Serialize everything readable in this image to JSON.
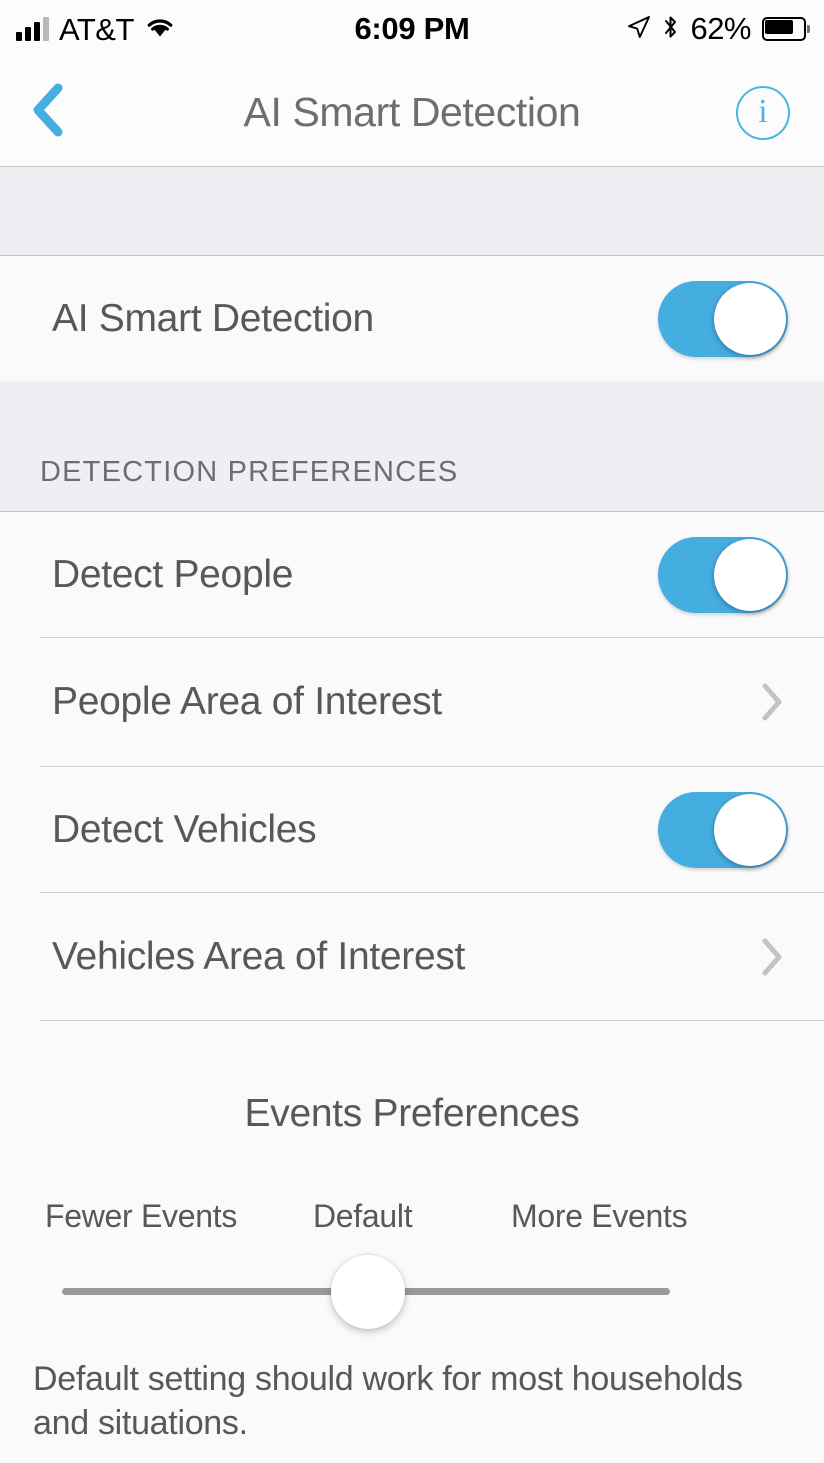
{
  "status_bar": {
    "carrier": "AT&T",
    "time": "6:09 PM",
    "battery_percent": "62%",
    "icons": {
      "signal": "cellular-signal-icon",
      "wifi": "wifi-icon",
      "location": "location-arrow-icon",
      "bluetooth": "bluetooth-icon",
      "battery": "battery-icon"
    }
  },
  "nav_bar": {
    "title": "AI Smart Detection",
    "back_icon": "chevron-left-icon",
    "info_label": "i",
    "info_icon": "info-circle-icon"
  },
  "sections": {
    "main": {
      "rows": [
        {
          "label": "AI Smart Detection",
          "control": "toggle",
          "value": "on"
        }
      ]
    },
    "detection_preferences": {
      "header": "DETECTION PREFERENCES",
      "rows": [
        {
          "label": "Detect People",
          "control": "toggle",
          "value": "on"
        },
        {
          "label": "People Area of Interest",
          "control": "disclosure"
        },
        {
          "label": "Detect Vehicles",
          "control": "toggle",
          "value": "on"
        },
        {
          "label": "Vehicles Area of Interest",
          "control": "disclosure"
        }
      ]
    },
    "events_preferences": {
      "title": "Events Preferences",
      "slider": {
        "labels": {
          "min": "Fewer Events",
          "mid": "Default",
          "max": "More Events"
        },
        "value": "Default",
        "position_percent": 50
      },
      "footer": "Default setting should work for most households and situations."
    }
  },
  "colors": {
    "accent_blue": "#44aee1",
    "info_blue": "#4bb4e8",
    "section_gray": "#efeef3",
    "row_bg": "#fafafa",
    "text_gray": "#58585b",
    "header_gray": "#6d6d72",
    "separator": "#d2d2d4",
    "chevron_gray": "#c2c3c7",
    "track_gray": "#9a9a9a"
  }
}
